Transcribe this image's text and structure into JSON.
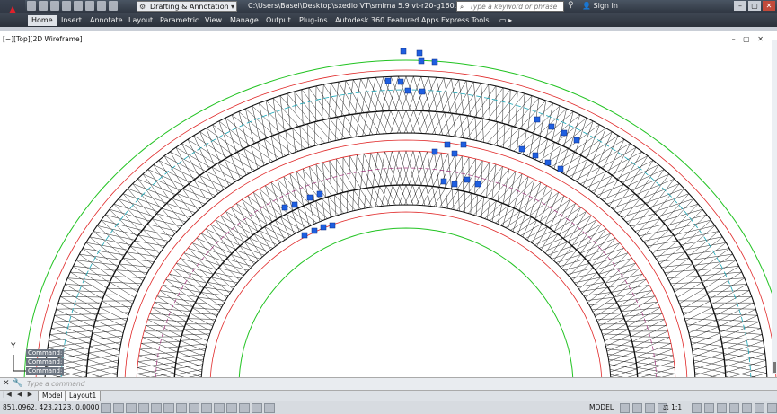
{
  "title": {
    "workspace": "Drafting & Annotation",
    "file_path": "C:\\Users\\Basel\\Desktop\\sxedio VT\\smima 5.9 vt-r20-g160.dwg",
    "search_placeholder": "Type a keyword or phrase",
    "sign_in": "Sign In"
  },
  "menu": {
    "tabs": [
      "Home",
      "Insert",
      "Annotate",
      "Layout",
      "Parametric",
      "View",
      "Manage",
      "Output",
      "Plug-ins",
      "Autodesk 360",
      "Featured Apps",
      "Express Tools"
    ]
  },
  "viewport": {
    "label": "[−][Top][2D Wireframe]",
    "y_axis": "Y"
  },
  "command": {
    "history": [
      "Command:",
      "Command:",
      "Command:"
    ],
    "placeholder": "Type a command"
  },
  "layouts": {
    "tabs": [
      "Model",
      "Layout1"
    ]
  },
  "status": {
    "coords": "851.0962, 423.2123, 0.0000",
    "model": "MODEL",
    "scale": "1:1"
  },
  "colors": {
    "arc_green": "#22c322",
    "arc_red": "#e02828",
    "arc_cyan": "#1aa7b8",
    "arc_magenta": "#a0307a",
    "grip_blue": "#1f5fe0",
    "hatch_black": "#111111"
  }
}
